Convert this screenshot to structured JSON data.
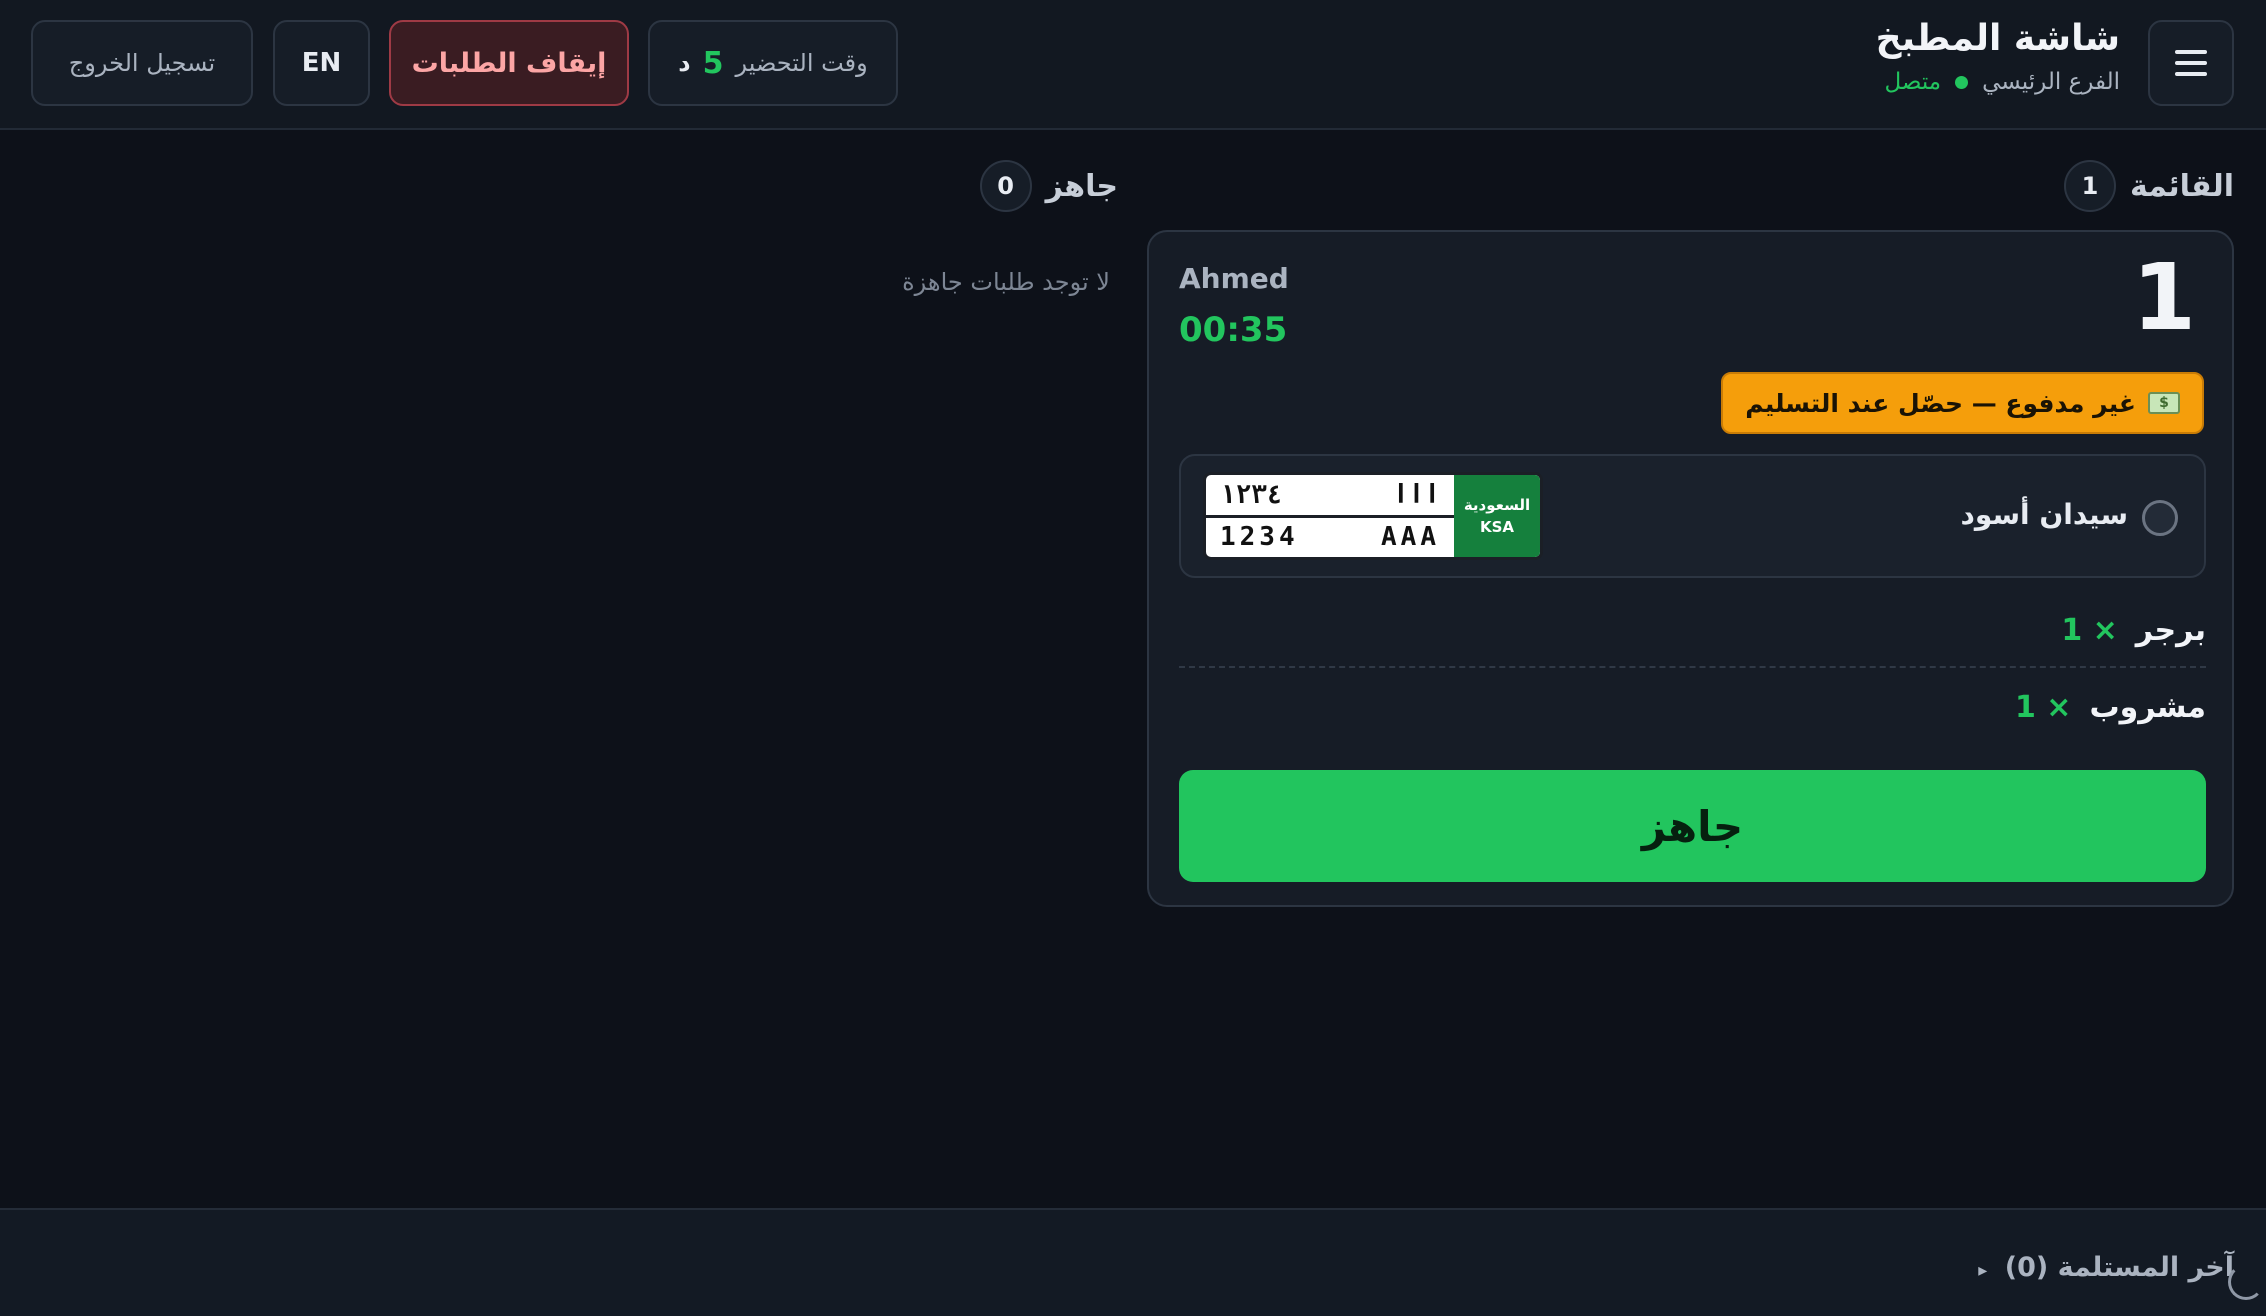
{
  "header": {
    "title": "شاشة المطبخ",
    "branch": "الفرع الرئيسي",
    "connection_status": "متصل",
    "prep_time": {
      "label": "وقت التحضير",
      "value": "5",
      "unit": "د"
    },
    "pause_orders_label": "إيقاف الطلبات",
    "language_label": "EN",
    "logout_label": "تسجيل الخروج"
  },
  "queue": {
    "title": "القائمة",
    "count": "1",
    "orders": [
      {
        "number": "1",
        "customer": "Ahmed",
        "elapsed": "00:35",
        "payment_badge": "غير مدفوع — حصّل عند التسليم",
        "car": {
          "description": "سيدان أسود",
          "plate_arabic_digits": "١٢٣٤",
          "plate_arabic_letters": "ااا",
          "plate_latin_digits": "1234",
          "plate_latin_letters": "AAA",
          "plate_country_ar": "السعودية",
          "plate_country_en": "KSA"
        },
        "items": [
          {
            "qty": "× 1",
            "name": "برجر"
          },
          {
            "qty": "× 1",
            "name": "مشروب"
          }
        ],
        "ready_label": "جاهز"
      }
    ]
  },
  "ready": {
    "title": "جاهز",
    "count": "0",
    "empty_message": "لا توجد طلبات جاهزة"
  },
  "footer": {
    "recent_label": "آخر المستلمة (0)",
    "toggle_arrow": "▸"
  },
  "icons": {
    "menu": "hamburger-icon",
    "status": "status-dot-icon",
    "cash": "cash-icon",
    "radio": "radio-icon",
    "loading": "spinner-icon"
  },
  "colors": {
    "background": "#0d1119",
    "accent_green": "#22c55e",
    "warning_amber": "#f59e0b",
    "danger_red": "#fca5a5",
    "plate_green": "#15803d"
  }
}
